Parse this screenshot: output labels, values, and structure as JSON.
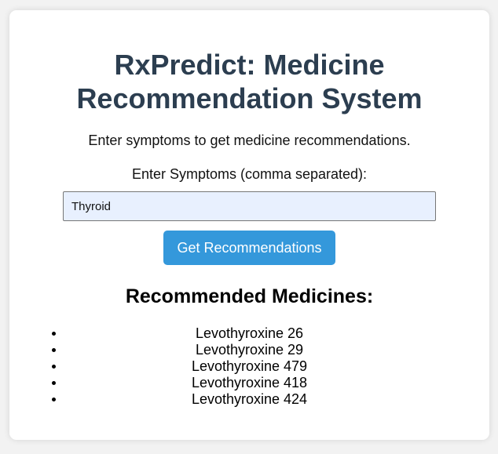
{
  "header": {
    "title_line1": "RxPredict: Medicine",
    "title_line2": "Recommendation System"
  },
  "intro": {
    "subtitle": "Enter symptoms to get medicine recommendations."
  },
  "form": {
    "label": "Enter Symptoms (comma separated):",
    "input_value": "Thyroid",
    "button_label": "Get Recommendations"
  },
  "results": {
    "heading": "Recommended Medicines:",
    "items": [
      "Levothyroxine 26",
      "Levothyroxine 29",
      "Levothyroxine 479",
      "Levothyroxine 418",
      "Levothyroxine 424"
    ]
  },
  "colors": {
    "title": "#2c3e50",
    "accent": "#3498db",
    "input_background": "#e8f0fe",
    "page_background": "#f2f2f2"
  }
}
